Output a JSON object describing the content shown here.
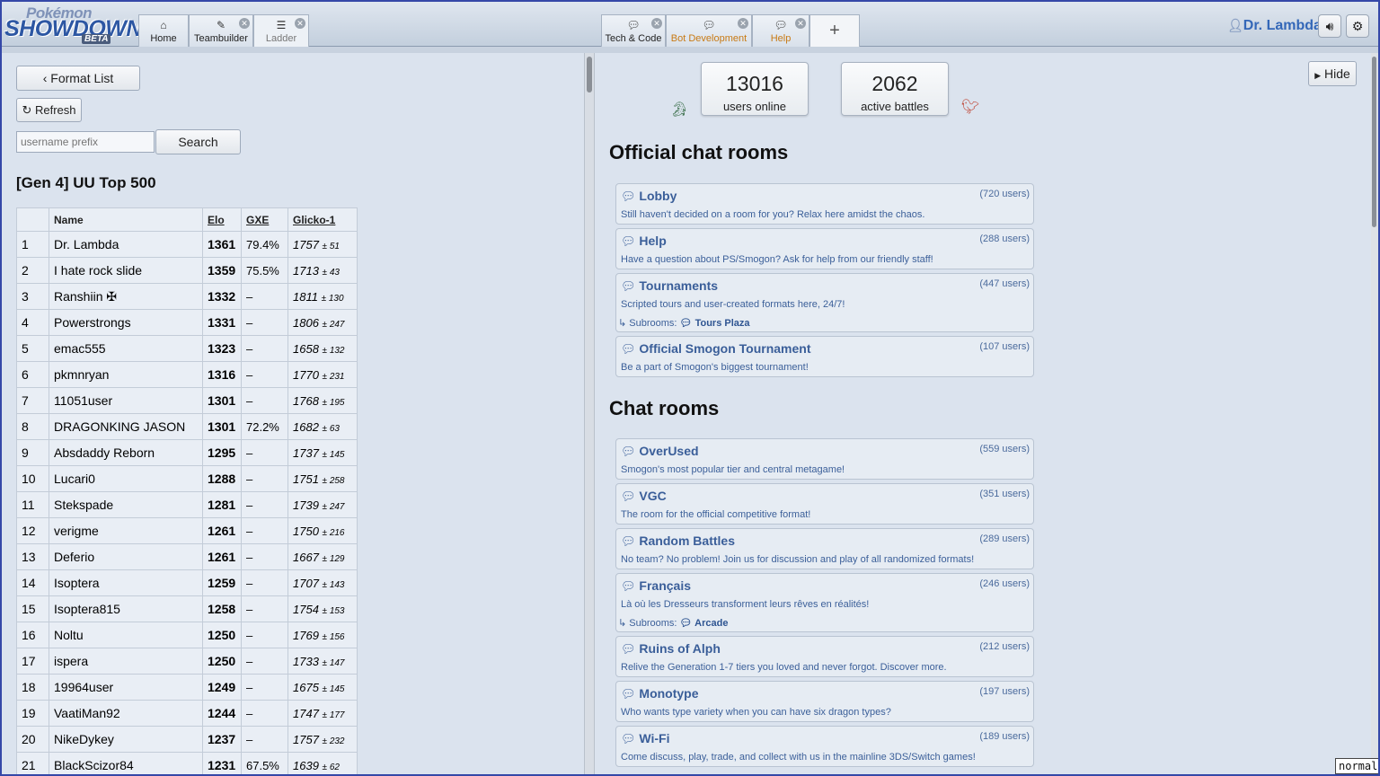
{
  "app": {
    "logo_top": "Pokémon",
    "logo_main": "SHOWDOWN!",
    "logo_beta": "BETA"
  },
  "tabs_left": [
    {
      "label": "Home",
      "icon": "home-icon"
    },
    {
      "label": "Teambuilder",
      "icon": "edit-icon"
    },
    {
      "label": "Ladder",
      "icon": "list-icon"
    }
  ],
  "tabs_center": [
    {
      "label": "Tech & Code",
      "icon": "chat-icon"
    },
    {
      "label": "Bot Development",
      "icon": "chat-icon",
      "color": "#c87a14"
    },
    {
      "label": "Help",
      "icon": "chat-icon",
      "color": "#c87a14"
    },
    {
      "label": "+",
      "icon": "plus-icon"
    }
  ],
  "user": {
    "name": "Dr. Lambda"
  },
  "left": {
    "format_list_label": "Format List",
    "refresh_label": "Refresh",
    "search_placeholder": "username prefix",
    "search_label": "Search",
    "ladder_title": "[Gen 4] UU Top 500",
    "columns": {
      "name": "Name",
      "elo": "Elo",
      "gxe": "GXE",
      "glicko": "Glicko-1"
    },
    "rows": [
      {
        "rank": "1",
        "name": "Dr. Lambda",
        "elo": "1361",
        "gxe": "79.4%",
        "glicko": "1757",
        "dev": "± 51"
      },
      {
        "rank": "2",
        "name": "I hate rock slide",
        "elo": "1359",
        "gxe": "75.5%",
        "glicko": "1713",
        "dev": "± 43"
      },
      {
        "rank": "3",
        "name": "Ranshiin ✠",
        "elo": "1332",
        "gxe": "–",
        "glicko": "1811",
        "dev": "± 130"
      },
      {
        "rank": "4",
        "name": "Powerstrongs",
        "elo": "1331",
        "gxe": "–",
        "glicko": "1806",
        "dev": "± 247"
      },
      {
        "rank": "5",
        "name": "emac555",
        "elo": "1323",
        "gxe": "–",
        "glicko": "1658",
        "dev": "± 132"
      },
      {
        "rank": "6",
        "name": "pkmnryan",
        "elo": "1316",
        "gxe": "–",
        "glicko": "1770",
        "dev": "± 231"
      },
      {
        "rank": "7",
        "name": "11051user",
        "elo": "1301",
        "gxe": "–",
        "glicko": "1768",
        "dev": "± 195"
      },
      {
        "rank": "8",
        "name": "DRAGONKING JASON",
        "elo": "1301",
        "gxe": "72.2%",
        "glicko": "1682",
        "dev": "± 63"
      },
      {
        "rank": "9",
        "name": "Absdaddy Reborn",
        "elo": "1295",
        "gxe": "–",
        "glicko": "1737",
        "dev": "± 145"
      },
      {
        "rank": "10",
        "name": "Lucari0",
        "elo": "1288",
        "gxe": "–",
        "glicko": "1751",
        "dev": "± 258"
      },
      {
        "rank": "11",
        "name": "Stekspade",
        "elo": "1281",
        "gxe": "–",
        "glicko": "1739",
        "dev": "± 247"
      },
      {
        "rank": "12",
        "name": "verigme",
        "elo": "1261",
        "gxe": "–",
        "glicko": "1750",
        "dev": "± 216"
      },
      {
        "rank": "13",
        "name": "Deferio",
        "elo": "1261",
        "gxe": "–",
        "glicko": "1667",
        "dev": "± 129"
      },
      {
        "rank": "14",
        "name": "Isoptera",
        "elo": "1259",
        "gxe": "–",
        "glicko": "1707",
        "dev": "± 143"
      },
      {
        "rank": "15",
        "name": "Isoptera815",
        "elo": "1258",
        "gxe": "–",
        "glicko": "1754",
        "dev": "± 153"
      },
      {
        "rank": "16",
        "name": "Noltu",
        "elo": "1250",
        "gxe": "–",
        "glicko": "1769",
        "dev": "± 156"
      },
      {
        "rank": "17",
        "name": "ispera",
        "elo": "1250",
        "gxe": "–",
        "glicko": "1733",
        "dev": "± 147"
      },
      {
        "rank": "18",
        "name": "19964user",
        "elo": "1249",
        "gxe": "–",
        "glicko": "1675",
        "dev": "± 145"
      },
      {
        "rank": "19",
        "name": "VaatiMan92",
        "elo": "1244",
        "gxe": "–",
        "glicko": "1747",
        "dev": "± 177"
      },
      {
        "rank": "20",
        "name": "NikeDykey",
        "elo": "1237",
        "gxe": "–",
        "glicko": "1757",
        "dev": "± 232"
      },
      {
        "rank": "21",
        "name": "BlackScizor84",
        "elo": "1231",
        "gxe": "67.5%",
        "glicko": "1639",
        "dev": "± 62"
      }
    ]
  },
  "right": {
    "users_online": "13016",
    "users_online_label": "users online",
    "active_battles": "2062",
    "active_battles_label": "active battles",
    "hide_label": "Hide",
    "official_heading": "Official chat rooms",
    "chat_heading": "Chat rooms",
    "subrooms_label": "Subrooms:",
    "official_rooms": [
      {
        "name": "Lobby",
        "users": "(720 users)",
        "desc": "Still haven't decided on a room for you? Relax here amidst the chaos."
      },
      {
        "name": "Help",
        "users": "(288 users)",
        "desc": "Have a question about PS/Smogon? Ask for help from our friendly staff!"
      },
      {
        "name": "Tournaments",
        "users": "(447 users)",
        "desc": "Scripted tours and user-created formats here, 24/7!",
        "subroom": "Tours Plaza"
      },
      {
        "name": "Official Smogon Tournament",
        "users": "(107 users)",
        "desc": "Be a part of Smogon's biggest tournament!"
      }
    ],
    "chat_rooms": [
      {
        "name": "OverUsed",
        "users": "(559 users)",
        "desc": "Smogon's most popular tier and central metagame!"
      },
      {
        "name": "VGC",
        "users": "(351 users)",
        "desc": "The room for the official competitive format!"
      },
      {
        "name": "Random Battles",
        "users": "(289 users)",
        "desc": "No team? No problem! Join us for discussion and play of all randomized formats!"
      },
      {
        "name": "Français",
        "users": "(246 users)",
        "desc": "Là où les Dresseurs transforment leurs rêves en réalités!",
        "subroom": "Arcade"
      },
      {
        "name": "Ruins of Alph",
        "users": "(212 users)",
        "desc": "Relive the Generation 1-7 tiers you loved and never forgot. Discover more."
      },
      {
        "name": "Monotype",
        "users": "(197 users)",
        "desc": "Who wants type variety when you can have six dragon types?"
      },
      {
        "name": "Wi-Fi",
        "users": "(189 users)",
        "desc": "Come discuss, play, trade, and collect with us in the mainline 3DS/Switch games!"
      }
    ]
  },
  "status_badge": "normal"
}
